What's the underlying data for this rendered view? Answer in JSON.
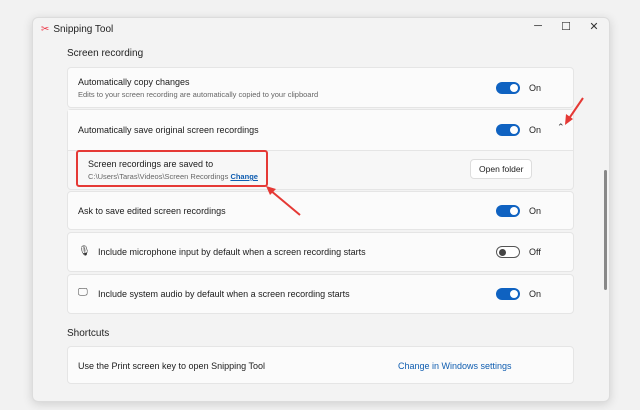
{
  "window": {
    "title": "Snipping Tool",
    "minimize": "─",
    "maximize": "☐",
    "close": "✕"
  },
  "sections": {
    "screen_recording": "Screen recording",
    "shortcuts": "Shortcuts"
  },
  "settings": [
    {
      "label": "Automatically copy changes",
      "description": "Edits to your screen recording are automatically copied to your clipboard",
      "state": "On"
    },
    {
      "label": "Automatically save original screen recordings",
      "state": "On",
      "expanded": true
    },
    {
      "label": "Ask to save edited screen recordings",
      "state": "On"
    },
    {
      "label": "Include microphone input by default when a screen recording starts",
      "state": "Off",
      "icon": "microphone-icon"
    },
    {
      "label": "Include system audio by default when a screen recording starts",
      "state": "On",
      "icon": "monitor-audio-icon"
    }
  ],
  "save_location": {
    "label": "Screen recordings are saved to",
    "path": "C:\\Users\\Taras\\Videos\\Screen Recordings",
    "change": "Change",
    "open_folder": "Open folder"
  },
  "shortcut": {
    "label": "Use the Print screen key to open Snipping Tool",
    "link": "Change in Windows settings"
  },
  "colors": {
    "accent": "#0f62c1",
    "annotation": "#e53935"
  }
}
